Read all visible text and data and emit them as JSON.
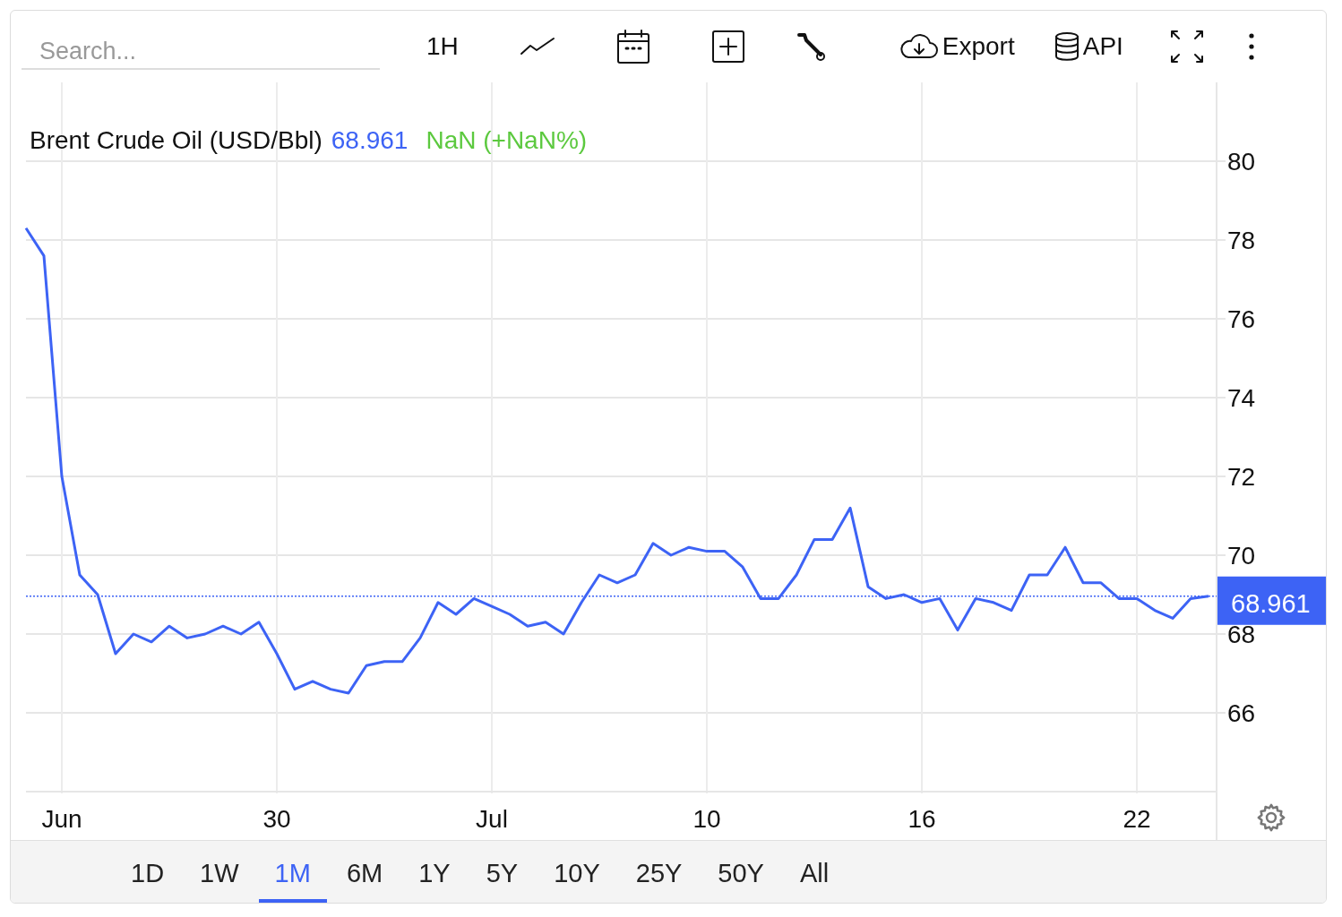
{
  "search": {
    "placeholder": "Search..."
  },
  "toolbar": [
    {
      "kind": "interval",
      "label": "1H"
    },
    {
      "kind": "chart-type"
    },
    {
      "kind": "calendar"
    },
    {
      "kind": "add"
    },
    {
      "kind": "tools"
    },
    {
      "kind": "export",
      "label": "Export"
    },
    {
      "kind": "api",
      "label": "API"
    },
    {
      "kind": "fullscreen"
    },
    {
      "kind": "more"
    }
  ],
  "legend": {
    "price": "68.961",
    "change": "NaN (+NaN%)"
  },
  "price_label": "68.961",
  "chart_data": {
    "type": "line",
    "categories": [
      null,
      null,
      "Jun",
      null,
      null,
      null,
      null,
      null,
      null,
      null,
      null,
      null,
      null,
      null,
      "30",
      null,
      null,
      null,
      null,
      null,
      null,
      null,
      null,
      null,
      null,
      null,
      "Jul",
      null,
      null,
      null,
      null,
      null,
      null,
      null,
      null,
      null,
      null,
      null,
      "10",
      null,
      null,
      null,
      null,
      null,
      null,
      null,
      null,
      null,
      null,
      null,
      "16",
      null,
      null,
      null,
      null,
      null,
      null,
      null,
      null,
      null,
      null,
      null,
      "22",
      null,
      null,
      null,
      null
    ],
    "series": [
      {
        "name": "Brent Crude Oil (USD/Bbl)",
        "color": "#3d63f5",
        "values": [
          78.3,
          77.6,
          72,
          69.5,
          69,
          67.5,
          68,
          67.8,
          68.2,
          67.9,
          68,
          68.2,
          68,
          68.3,
          67.5,
          66.6,
          66.8,
          66.6,
          66.5,
          67.2,
          67.3,
          67.3,
          67.9,
          68.8,
          68.5,
          68.9,
          68.7,
          68.5,
          68.2,
          68.3,
          68,
          68.8,
          69.5,
          69.3,
          69.5,
          70.3,
          70,
          70.2,
          70.1,
          70.1,
          69.7,
          68.9,
          68.9,
          69.5,
          70.4,
          70.4,
          71.2,
          69.2,
          68.9,
          69,
          68.8,
          68.9,
          68.1,
          68.9,
          68.8,
          68.6,
          69.5,
          69.5,
          70.2,
          69.3,
          69.3,
          68.9,
          68.9,
          68.6,
          68.4,
          68.9,
          68.96
        ]
      }
    ],
    "yticks": [
      66,
      68,
      70,
      72,
      74,
      76,
      78,
      80
    ],
    "ylim": [
      64,
      82
    ],
    "grid": true,
    "ref_lines": [
      {
        "axis": "y",
        "value": 68.961,
        "color": "#3d63f5"
      }
    ]
  },
  "ranges": [
    {
      "label": "1D",
      "selected": false
    },
    {
      "label": "1W",
      "selected": false
    },
    {
      "label": "1M",
      "selected": true
    },
    {
      "label": "6M",
      "selected": false
    },
    {
      "label": "1Y",
      "selected": false
    },
    {
      "label": "5Y",
      "selected": false
    },
    {
      "label": "10Y",
      "selected": false
    },
    {
      "label": "25Y",
      "selected": false
    },
    {
      "label": "50Y",
      "selected": false
    },
    {
      "label": "All",
      "selected": false
    }
  ]
}
